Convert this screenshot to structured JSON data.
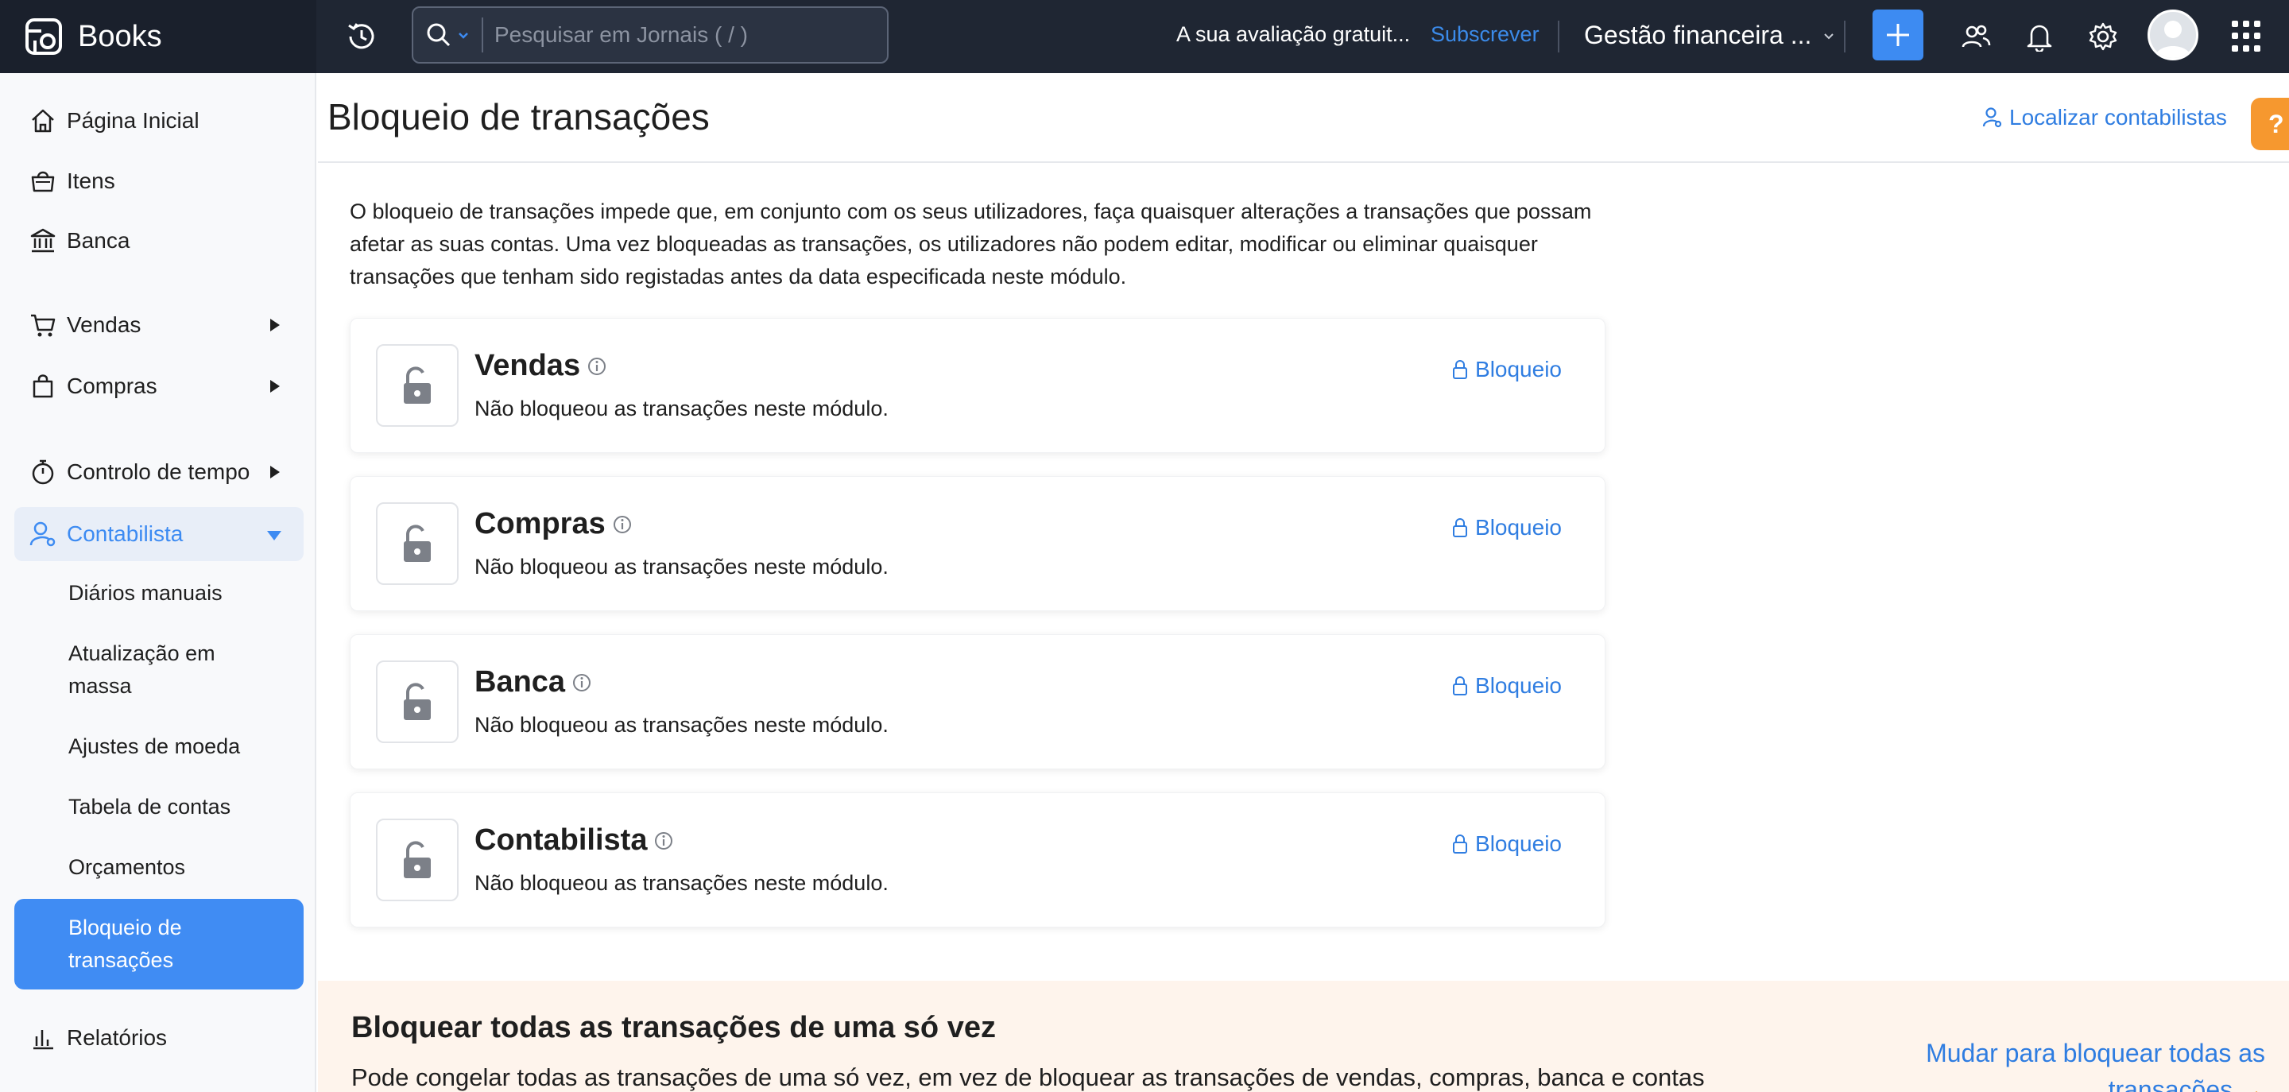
{
  "app": {
    "name": "Books"
  },
  "topbar": {
    "search_placeholder": "Pesquisar em Jornais ( / )",
    "trial_text": "A sua avaliação gratuit...",
    "subscribe_label": "Subscrever",
    "org_name": "Gestão financeira ...",
    "accent_color": "#3d8bf2"
  },
  "sidebar": {
    "items": [
      {
        "label": "Página Inicial",
        "icon": "home-icon"
      },
      {
        "label": "Itens",
        "icon": "basket-icon"
      },
      {
        "label": "Banca",
        "icon": "bank-icon"
      },
      {
        "label": "Vendas",
        "icon": "cart-icon"
      },
      {
        "label": "Compras",
        "icon": "bag-icon"
      },
      {
        "label": "Controlo de tempo",
        "icon": "stopwatch-icon"
      },
      {
        "label": "Contabilista",
        "icon": "accountant-icon"
      },
      {
        "label": "Relatórios",
        "icon": "reports-icon"
      }
    ],
    "sub_items": [
      {
        "label": "Diários manuais"
      },
      {
        "label": "Atualização em massa"
      },
      {
        "label": "Ajustes de moeda"
      },
      {
        "label": "Tabela de contas"
      },
      {
        "label": "Orçamentos"
      },
      {
        "label": "Bloqueio de transações"
      }
    ]
  },
  "page": {
    "title": "Bloqueio de transações",
    "find_accountants_label": "Localizar contabilistas",
    "help_label": "?",
    "intro": "O bloqueio de transações impede que, em conjunto com os seus utilizadores, faça quaisquer alterações a transações que possam afetar as suas contas. Uma vez bloqueadas as transações, os utilizadores não podem editar, modificar ou eliminar quaisquer transações que tenham sido registadas antes da data especificada neste módulo."
  },
  "modules": [
    {
      "title": "Vendas",
      "status": "Não bloqueou as transações neste módulo.",
      "action_label": "Bloqueio"
    },
    {
      "title": "Compras",
      "status": "Não bloqueou as transações neste módulo.",
      "action_label": "Bloqueio"
    },
    {
      "title": "Banca",
      "status": "Não bloqueou as transações neste módulo.",
      "action_label": "Bloqueio"
    },
    {
      "title": "Contabilista",
      "status": "Não bloqueou as transações neste módulo.",
      "action_label": "Bloqueio"
    }
  ],
  "bulk_lock": {
    "title": "Bloquear todas as transações de uma só vez",
    "description": "Pode congelar todas as transações de uma só vez, em vez de bloquear as transações de vendas, compras, banca e contas",
    "link_label": "Mudar para bloquear todas as transações",
    "arrow": "→"
  }
}
